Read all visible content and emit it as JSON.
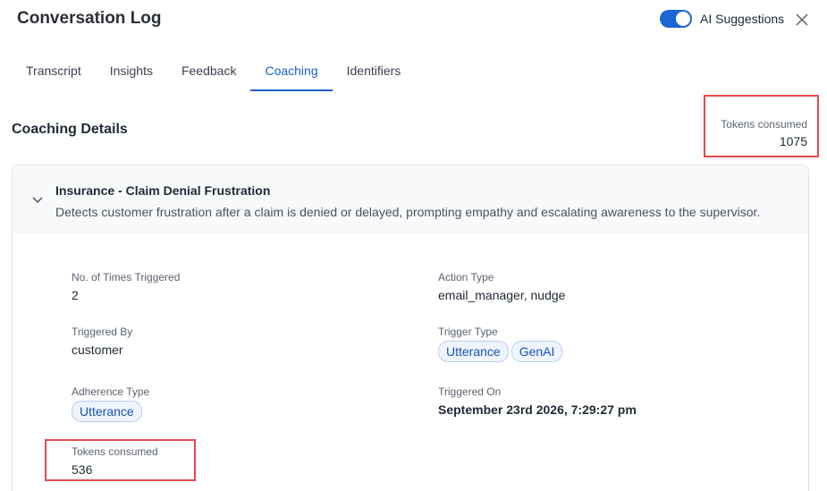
{
  "header": {
    "title": "Conversation Log",
    "ai_suggestions_label": "AI Suggestions",
    "ai_suggestions_on": true,
    "toggle_color": "#1a66d6"
  },
  "tabs": [
    {
      "label": "Transcript",
      "active": false
    },
    {
      "label": "Insights",
      "active": false
    },
    {
      "label": "Feedback",
      "active": false
    },
    {
      "label": "Coaching",
      "active": true
    },
    {
      "label": "Identifiers",
      "active": false
    }
  ],
  "coaching": {
    "section_title": "Coaching Details",
    "tokens_label": "Tokens consumed",
    "tokens_value": "1075",
    "card": {
      "title": "Insurance - Claim Denial Frustration",
      "description": "Detects customer frustration after a claim is denied or delayed, prompting empathy and escalating awareness to the supervisor.",
      "fields": {
        "times_triggered": {
          "label": "No. of Times Triggered",
          "value": "2"
        },
        "action_type": {
          "label": "Action Type",
          "value": "email_manager, nudge"
        },
        "triggered_by": {
          "label": "Triggered By",
          "value": "customer"
        },
        "trigger_type": {
          "label": "Trigger Type",
          "chips": [
            "Utterance",
            "GenAI"
          ]
        },
        "adherence_type": {
          "label": "Adherence Type",
          "chips": [
            "Utterance"
          ]
        },
        "triggered_on": {
          "label": "Triggered On",
          "value": "September 23rd 2026, 7:29:27 pm"
        },
        "tokens": {
          "label": "Tokens consumed",
          "value": "536"
        }
      }
    }
  },
  "colors": {
    "accent": "#1a5fc4",
    "highlight": "#e24b4b"
  }
}
